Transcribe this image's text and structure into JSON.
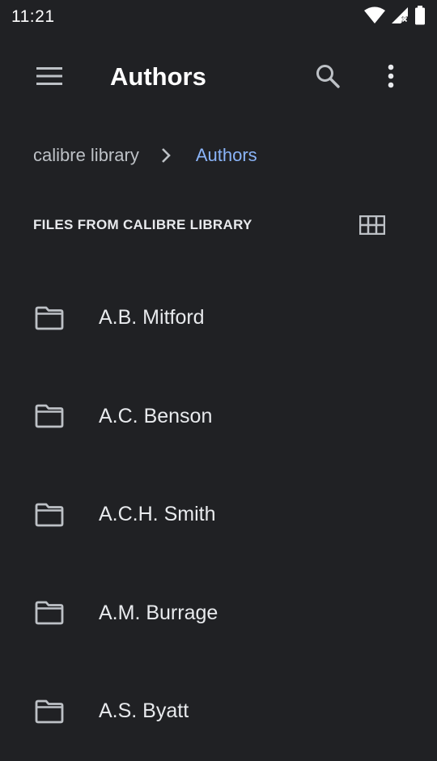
{
  "status_bar": {
    "time": "11:21",
    "icons": [
      "wifi-icon",
      "signal-icon",
      "battery-icon"
    ]
  },
  "app_bar": {
    "title": "Authors",
    "menu_icon": "hamburger-menu-icon",
    "search_icon": "search-icon",
    "more_icon": "more-vert-icon"
  },
  "breadcrumb": {
    "root": "calibre library",
    "separator_icon": "chevron-right-icon",
    "current": "Authors"
  },
  "section": {
    "header": "FILES FROM CALIBRE LIBRARY",
    "view_toggle_icon": "grid-view-icon"
  },
  "files": [
    {
      "name": "A.B. Mitford",
      "icon": "folder-icon"
    },
    {
      "name": "A.C. Benson",
      "icon": "folder-icon"
    },
    {
      "name": "A.C.H. Smith",
      "icon": "folder-icon"
    },
    {
      "name": "A.M. Burrage",
      "icon": "folder-icon"
    },
    {
      "name": "A.S. Byatt",
      "icon": "folder-icon"
    }
  ],
  "colors": {
    "background": "#202124",
    "accent": "#8ab4f8",
    "text_primary": "#e8eaed",
    "text_secondary": "#bdc1c6"
  }
}
